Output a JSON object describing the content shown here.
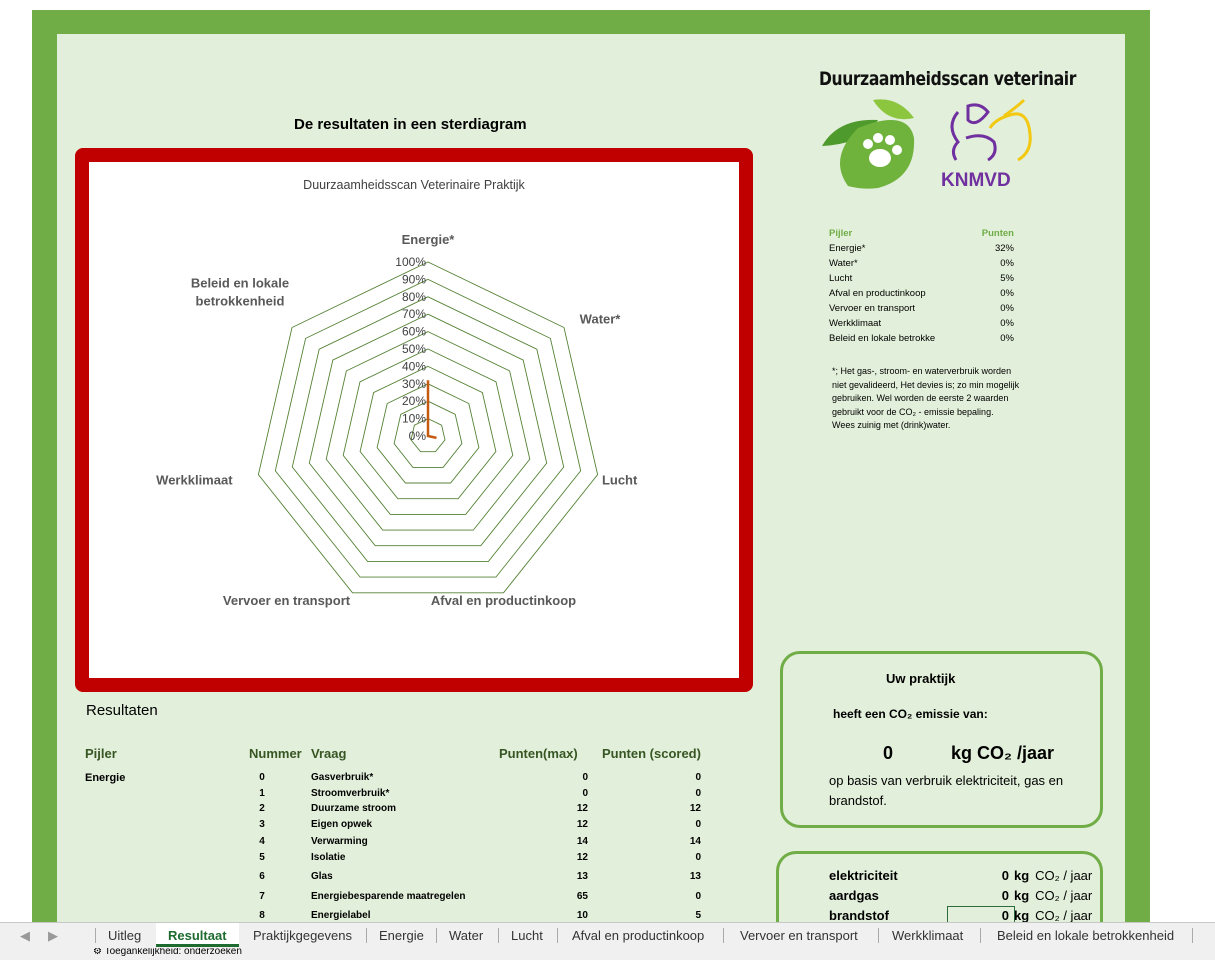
{
  "chart_heading": "De resultaten in een sterdiagram",
  "app_title": "Duurzaamheidsscan veterinair",
  "logo_text": "KNMVD",
  "chart_data": {
    "type": "radar",
    "title": "Duurzaamheidsscan Veterinaire Praktijk",
    "categories": [
      "Energie*",
      "Water*",
      "Lucht",
      "Afval en productinkoop",
      "Vervoer en transport",
      "Werkklimaat",
      "Beleid en lokale betrokkenheid"
    ],
    "category_lines": [
      [
        "Energie*"
      ],
      [
        "Water*"
      ],
      [
        "Lucht"
      ],
      [
        "Afval en productinkoop"
      ],
      [
        "Vervoer en transport"
      ],
      [
        "Werkklimaat"
      ],
      [
        "Beleid en lokale",
        "betrokkenheid"
      ]
    ],
    "values": [
      32,
      0,
      5,
      0,
      0,
      0,
      0
    ],
    "ticks": [
      "0%",
      "10%",
      "20%",
      "30%",
      "40%",
      "50%",
      "60%",
      "70%",
      "80%",
      "90%",
      "100%"
    ],
    "range": [
      0,
      100
    ],
    "grid_color": "#548235",
    "series_color": "#c55a11"
  },
  "pillar_table": {
    "header": [
      "Pijler",
      "Punten"
    ],
    "rows": [
      [
        "Energie*",
        "32%"
      ],
      [
        "Water*",
        "0%"
      ],
      [
        "Lucht",
        "5%"
      ],
      [
        "Afval en productinkoop",
        "0%"
      ],
      [
        "Vervoer en transport",
        "0%"
      ],
      [
        "Werkklimaat",
        "0%"
      ],
      [
        "Beleid en lokale betrokke",
        "0%"
      ]
    ]
  },
  "footnote": [
    "*; Het gas-, stroom- en waterverbruik worden",
    "niet gevalideerd,  Het devies is; zo min mogelijk",
    "gebruiken. Wel worden de eerste 2 waarden",
    "gebruikt voor de CO₂ - emissie bepaling.",
    "Wees zuinig met (drink)water."
  ],
  "co2": {
    "title": "Uw praktijk",
    "subtitle": "heeft een CO₂ emissie van:",
    "value": "0",
    "unit": "kg CO₂ /jaar",
    "basis": "op basis van verbruik elektriciteit, gas en brandstof."
  },
  "energy_rows": [
    {
      "label": "elektriciteit",
      "value": "0",
      "unit": "kg",
      "unit2": "CO₂ / jaar"
    },
    {
      "label": "aardgas",
      "value": "0",
      "unit": "kg",
      "unit2": "CO₂ / jaar"
    },
    {
      "label": "brandstof",
      "value": "0",
      "unit": "kg",
      "unit2": "CO₂ / jaar"
    }
  ],
  "results": {
    "title": "Resultaten",
    "headers": [
      "Pijler",
      "Nummer",
      "Vraag",
      "Punten(max)",
      "Punten (scored)"
    ],
    "pillar": "Energie",
    "rows": [
      [
        "0",
        "Gasverbruik*",
        "0",
        "0"
      ],
      [
        "1",
        "Stroomverbruik*",
        "0",
        "0"
      ],
      [
        "2",
        "Duurzame stroom",
        "12",
        "12"
      ],
      [
        "3",
        "Eigen opwek",
        "12",
        "0"
      ],
      [
        "4",
        "Verwarming",
        "14",
        "14"
      ],
      [
        "5",
        "Isolatie",
        "12",
        "0"
      ],
      [
        "6",
        "Glas",
        "13",
        "13"
      ],
      [
        "7",
        "Energiebesparende maatregelen",
        "65",
        "0"
      ],
      [
        "8",
        "Energielabel",
        "10",
        "5"
      ]
    ]
  },
  "tabs": [
    "Uitleg",
    "Resultaat",
    "Praktijkgegevens",
    "Energie",
    "Water",
    "Lucht",
    "Afval en productinkoop",
    "Vervoer en transport",
    "Werkklimaat",
    "Beleid en lokale betrokkenheid"
  ],
  "active_tab": "Resultaat",
  "status_text": "Toegankelijkheid: onderzoeken"
}
